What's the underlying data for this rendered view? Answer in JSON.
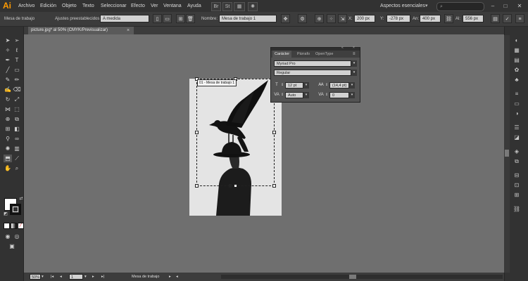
{
  "menubar": {
    "logo": "Ai",
    "items": [
      "Archivo",
      "Edición",
      "Objeto",
      "Texto",
      "Seleccionar",
      "Efecto",
      "Ver",
      "Ventana",
      "Ayuda"
    ],
    "icons": [
      "bridge-icon",
      "stock-icon",
      "arrange-documents-icon",
      "gpu-icon"
    ],
    "workspace": "Aspectos esenciales",
    "search_icon": "⌕",
    "window_buttons": [
      "–",
      "□",
      "✕"
    ]
  },
  "controlbar": {
    "label": "Mesa de trabajo",
    "presets_label": "Ajustes preestablecidos:",
    "preset_value": "A medida",
    "name_label": "Nombre:",
    "name_value": "Mesa de trabajo 1",
    "x_label": "X:",
    "x_value": "200 px",
    "y_label": "Y:",
    "y_value": "-278 px",
    "w_label": "An:",
    "w_value": "400 px",
    "h_label": "Al:",
    "h_value": "556 px"
  },
  "document": {
    "tab_title": "picture.jpg* al 50% (CMYK/Previsualizar)",
    "close_glyph": "×",
    "artboard_label": "01 - Mesa de trabajo 1"
  },
  "character_panel": {
    "tabs": [
      "Carácter",
      "Párrafo",
      "OpenType"
    ],
    "font_family": "Myriad Pro",
    "font_style": "Regular",
    "font_size": "12 pt",
    "leading": "(14,4 pt)",
    "kerning": "Auto",
    "tracking": "0"
  },
  "statusbar": {
    "zoom": "50%",
    "artboard_number": "1",
    "mode": "Mesa de trabajo"
  },
  "colors": {
    "accent": "#ff9a00",
    "canvas": "#6f6f6f",
    "artboard": "#e6e6e6"
  }
}
